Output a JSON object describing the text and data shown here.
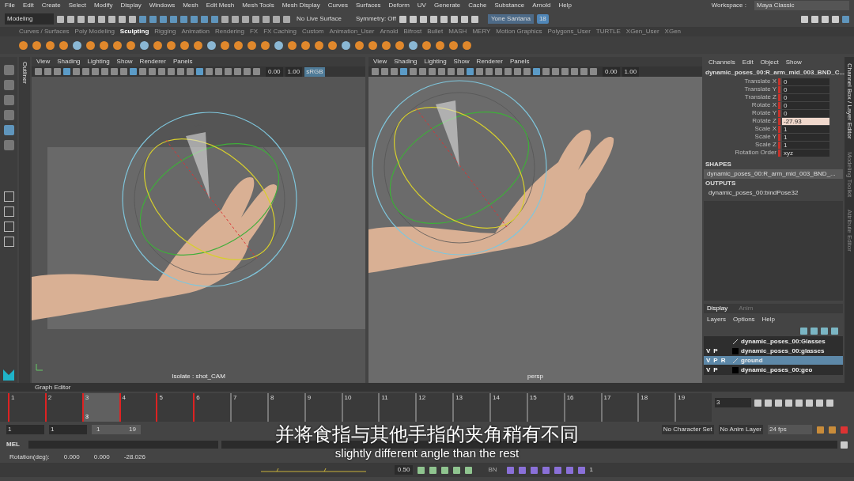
{
  "menu_bar": [
    "File",
    "Edit",
    "Create",
    "Select",
    "Modify",
    "Display",
    "Windows",
    "Mesh",
    "Edit Mesh",
    "Mesh Tools",
    "Mesh Display",
    "Curves",
    "Surfaces",
    "Deform",
    "UV",
    "Generate",
    "Cache",
    "Substance",
    "Arnold",
    "Help"
  ],
  "toolbar": {
    "mode": "Modeling",
    "live_surface": "No Live Surface",
    "symmetry": "Symmetry: Off",
    "user": "Yone Santana",
    "notifications": "18",
    "workspace_label": "Workspace :",
    "workspace": "Maya Classic"
  },
  "shelf_tabs": [
    {
      "label": "Curves / Surfaces",
      "selected": false
    },
    {
      "label": "Poly Modeling",
      "selected": false
    },
    {
      "label": "Sculpting",
      "selected": true
    },
    {
      "label": "Rigging",
      "selected": false
    },
    {
      "label": "Animation",
      "selected": false
    },
    {
      "label": "Rendering",
      "selected": false
    },
    {
      "label": "FX",
      "selected": false
    },
    {
      "label": "FX Caching",
      "selected": false
    },
    {
      "label": "Custom",
      "selected": false
    },
    {
      "label": "Animation_User",
      "selected": false
    },
    {
      "label": "Arnold",
      "selected": false
    },
    {
      "label": "Bifrost",
      "selected": false
    },
    {
      "label": "Bullet",
      "selected": false
    },
    {
      "label": "MASH",
      "selected": false
    },
    {
      "label": "MERY",
      "selected": false
    },
    {
      "label": "Motion Graphics",
      "selected": false
    },
    {
      "label": "Polygons_User",
      "selected": false
    },
    {
      "label": "TURTLE",
      "selected": false
    },
    {
      "label": "XGen_User",
      "selected": false
    },
    {
      "label": "XGen",
      "selected": false
    }
  ],
  "outliner_tab": "Outliner",
  "viewports": [
    {
      "menus": [
        "View",
        "Shading",
        "Lighting",
        "Show",
        "Renderer",
        "Panels"
      ],
      "exposure": "0.00",
      "gamma": "1.00",
      "color_space": "sRGB",
      "camera_label": "Isolate : shot_CAM",
      "film_gate": true
    },
    {
      "menus": [
        "View",
        "Shading",
        "Lighting",
        "Show",
        "Renderer",
        "Panels"
      ],
      "exposure": "0.00",
      "gamma": "1.00",
      "camera_label": "persp",
      "film_gate": false
    }
  ],
  "channel_box": {
    "menus": [
      "Channels",
      "Edit",
      "Object",
      "Show"
    ],
    "node": "dynamic_poses_00:R_arm_mid_003_BND_C...",
    "channels": [
      {
        "name": "Translate X",
        "value": "0",
        "selected": false
      },
      {
        "name": "Translate Y",
        "value": "0",
        "selected": false
      },
      {
        "name": "Translate Z",
        "value": "0",
        "selected": false
      },
      {
        "name": "Rotate X",
        "value": "0",
        "selected": false
      },
      {
        "name": "Rotate Y",
        "value": "0",
        "selected": false
      },
      {
        "name": "Rotate Z",
        "value": "-27.93",
        "selected": true
      },
      {
        "name": "Scale X",
        "value": "1",
        "selected": false
      },
      {
        "name": "Scale Y",
        "value": "1",
        "selected": false
      },
      {
        "name": "Scale Z",
        "value": "1",
        "selected": false
      },
      {
        "name": "Rotation Order",
        "value": "xyz",
        "selected": false
      }
    ],
    "shapes_heading": "SHAPES",
    "shapes": [
      "dynamic_poses_00:R_arm_mid_003_BND_..."
    ],
    "outputs_heading": "OUTPUTS",
    "outputs": [
      "dynamic_poses_00:bindPose32"
    ]
  },
  "side_tabs": [
    "Channel Box / Layer Editor",
    "Modeling Toolkit",
    "Attribute Editor"
  ],
  "layer_editor": {
    "tabs": [
      {
        "label": "Display",
        "selected": true
      },
      {
        "label": "Anim",
        "selected": false
      }
    ],
    "menus": [
      "Layers",
      "Options",
      "Help"
    ],
    "layers": [
      {
        "kind": "template",
        "name": "dynamic_poses_00:Glasses",
        "selected": false
      },
      {
        "flags": [
          "V",
          "P"
        ],
        "kind": "normal",
        "name": "dynamic_poses_00:glasses",
        "selected": false
      },
      {
        "flags": [
          "V",
          "P",
          "R"
        ],
        "kind": "template",
        "name": "ground",
        "selected": true
      },
      {
        "flags": [
          "V",
          "P"
        ],
        "kind": "normal",
        "name": "dynamic_poses_00:geo",
        "selected": false
      }
    ]
  },
  "graph_editor_label": "Graph Editor",
  "timeline": {
    "frames": [
      {
        "label": "1",
        "key": true,
        "current": false
      },
      {
        "label": "2",
        "key": true,
        "current": false
      },
      {
        "label": "3",
        "key": true,
        "current": true
      },
      {
        "label": "4",
        "key": true,
        "current": false
      },
      {
        "label": "5",
        "key": true,
        "current": false
      },
      {
        "label": "6",
        "key": true,
        "current": false
      },
      {
        "label": "7",
        "key": false,
        "current": false
      },
      {
        "label": "8",
        "key": false,
        "current": false
      },
      {
        "label": "9",
        "key": false,
        "current": false
      },
      {
        "label": "10",
        "key": false,
        "current": false
      },
      {
        "label": "11",
        "key": false,
        "current": false
      },
      {
        "label": "12",
        "key": false,
        "current": false
      },
      {
        "label": "13",
        "key": false,
        "current": false
      },
      {
        "label": "14",
        "key": false,
        "current": false
      },
      {
        "label": "15",
        "key": false,
        "current": false
      },
      {
        "label": "16",
        "key": false,
        "current": false
      },
      {
        "label": "17",
        "key": false,
        "current": false
      },
      {
        "label": "18",
        "key": false,
        "current": false
      },
      {
        "label": "19",
        "key": false,
        "current": false
      }
    ],
    "current_label": "3",
    "current_field": "3"
  },
  "range": {
    "start": "1",
    "playback_start": "1",
    "slider_start": "1",
    "slider_end": "19",
    "character_set": "No Character Set",
    "anim_layer": "No Anim Layer",
    "fps": "24 fps"
  },
  "command_line": {
    "label": "MEL"
  },
  "status": {
    "label": "Rotation(deg):",
    "values": [
      "0.000",
      "0.000",
      "-28.026"
    ]
  },
  "bottom_shelf": {
    "value": "0.50",
    "label": "BN",
    "count": "1"
  },
  "subtitles": {
    "zh": "并将食指与其他手指的夹角稍有不同",
    "en": "slightly different angle than the rest"
  }
}
